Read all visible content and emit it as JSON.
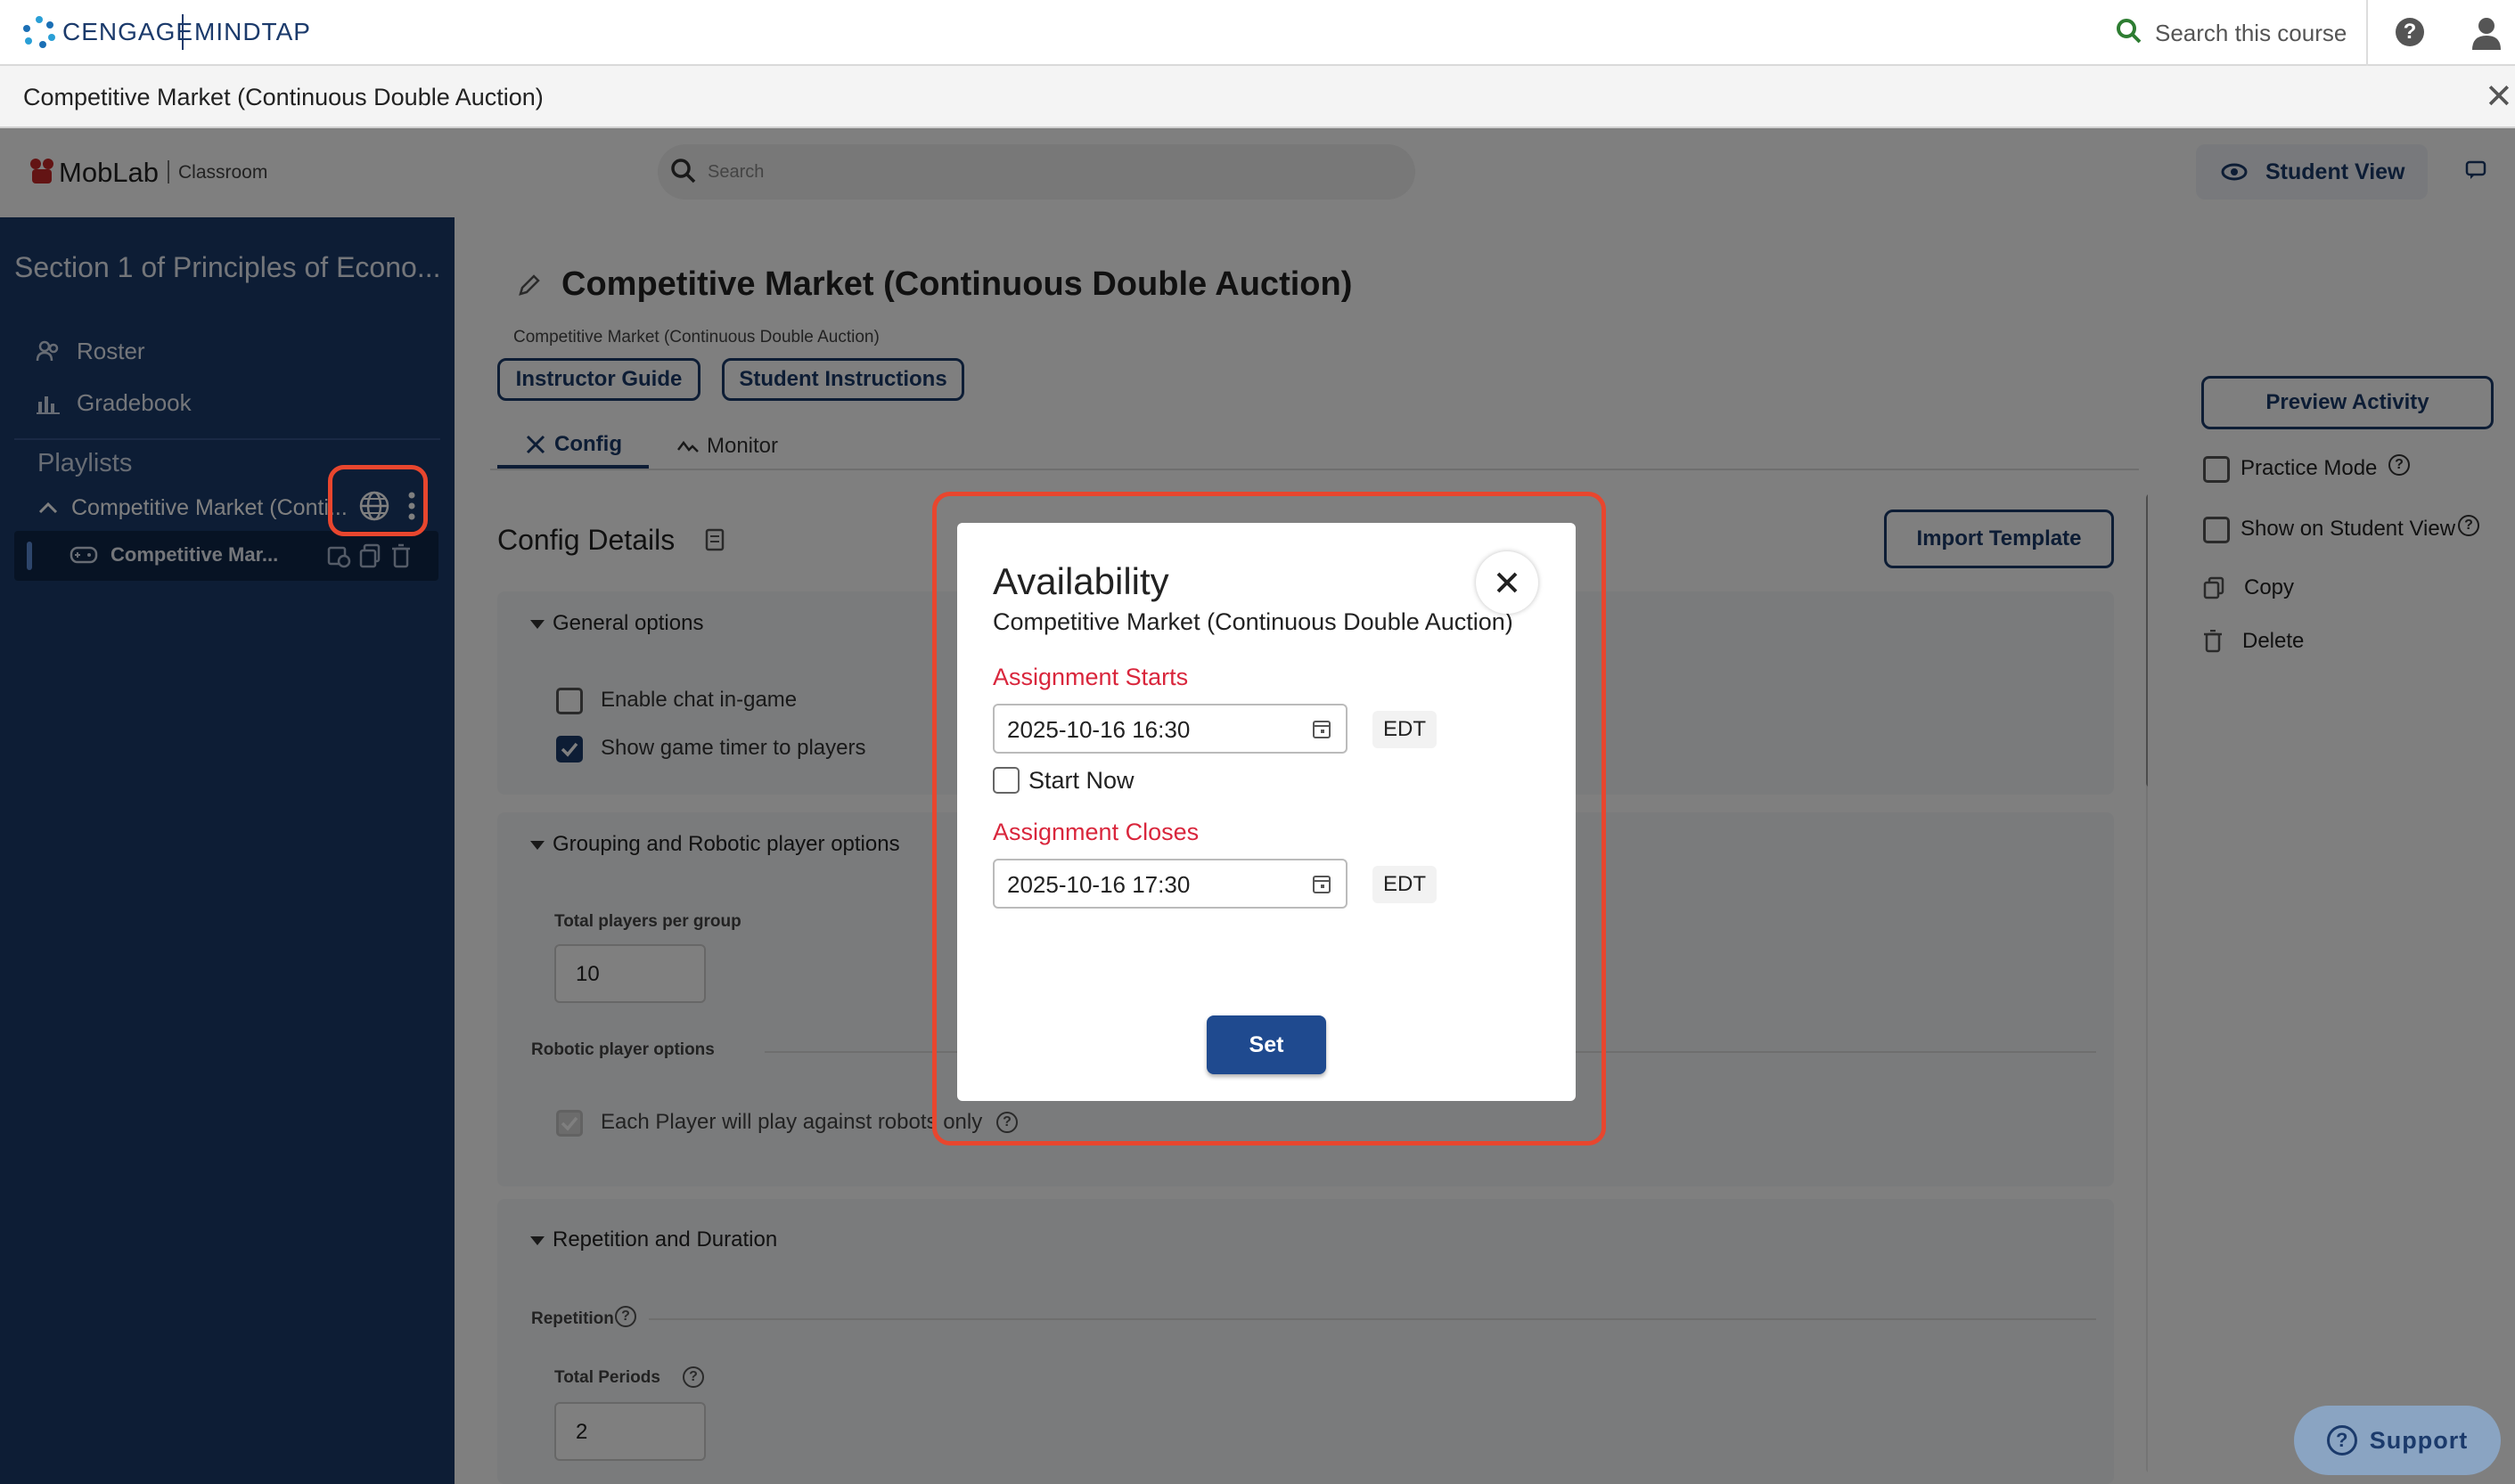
{
  "brand": {
    "cengage": "CENGAGE",
    "mindtap": "MINDTAP"
  },
  "topbar": {
    "search_label": "Search this course"
  },
  "course_title": "Competitive Market (Continuous Double Auction)",
  "mobbar": {
    "logo": "MobLab",
    "logo_sub": "Classroom",
    "search_placeholder": "Search",
    "student_view": "Student View"
  },
  "sidebar": {
    "section_title": "Section 1 of Principles of Econo...",
    "nav": [
      {
        "label": "Roster"
      },
      {
        "label": "Gradebook"
      }
    ],
    "playlists_label": "Playlists",
    "playlist_name": "Competitive Market (Conti...",
    "activity_name": "Competitive Mar..."
  },
  "main": {
    "title": "Competitive Market (Continuous Double Auction)",
    "subtitle": "Competitive Market (Continuous Double Auction)",
    "instructor_guide": "Instructor Guide",
    "student_instructions": "Student Instructions",
    "tabs": [
      {
        "label": "Config"
      },
      {
        "label": "Monitor"
      }
    ],
    "config_details": "Config Details",
    "import_template": "Import Template",
    "general_options": "General options",
    "enable_chat": "Enable chat in-game",
    "show_timer": "Show game timer to players",
    "grouping_options": "Grouping and Robotic player options",
    "total_players_label": "Total players per group",
    "total_players_value": "10",
    "robotic_label": "Robotic player options",
    "robots_only": "Each Player will play against robots only",
    "repetition_duration": "Repetition and Duration",
    "repetition": "Repetition",
    "total_periods_label": "Total Periods",
    "total_periods_value": "2"
  },
  "right_panel": {
    "preview": "Preview Activity",
    "practice_mode": "Practice Mode",
    "show_on_student": "Show on Student View",
    "copy": "Copy",
    "delete": "Delete",
    "support": "Support"
  },
  "modal": {
    "title": "Availability",
    "subtitle": "Competitive Market (Continuous Double Auction)",
    "starts_label": "Assignment Starts",
    "starts_value": "2025-10-16 16:30",
    "starts_tz": "EDT",
    "start_now": "Start Now",
    "closes_label": "Assignment Closes",
    "closes_value": "2025-10-16 17:30",
    "closes_tz": "EDT",
    "set": "Set"
  },
  "colors": {
    "navy": "#1b3a6b",
    "accent_red": "#e8462e",
    "label_red": "#d9263c",
    "set_button": "#1f4a8f"
  }
}
